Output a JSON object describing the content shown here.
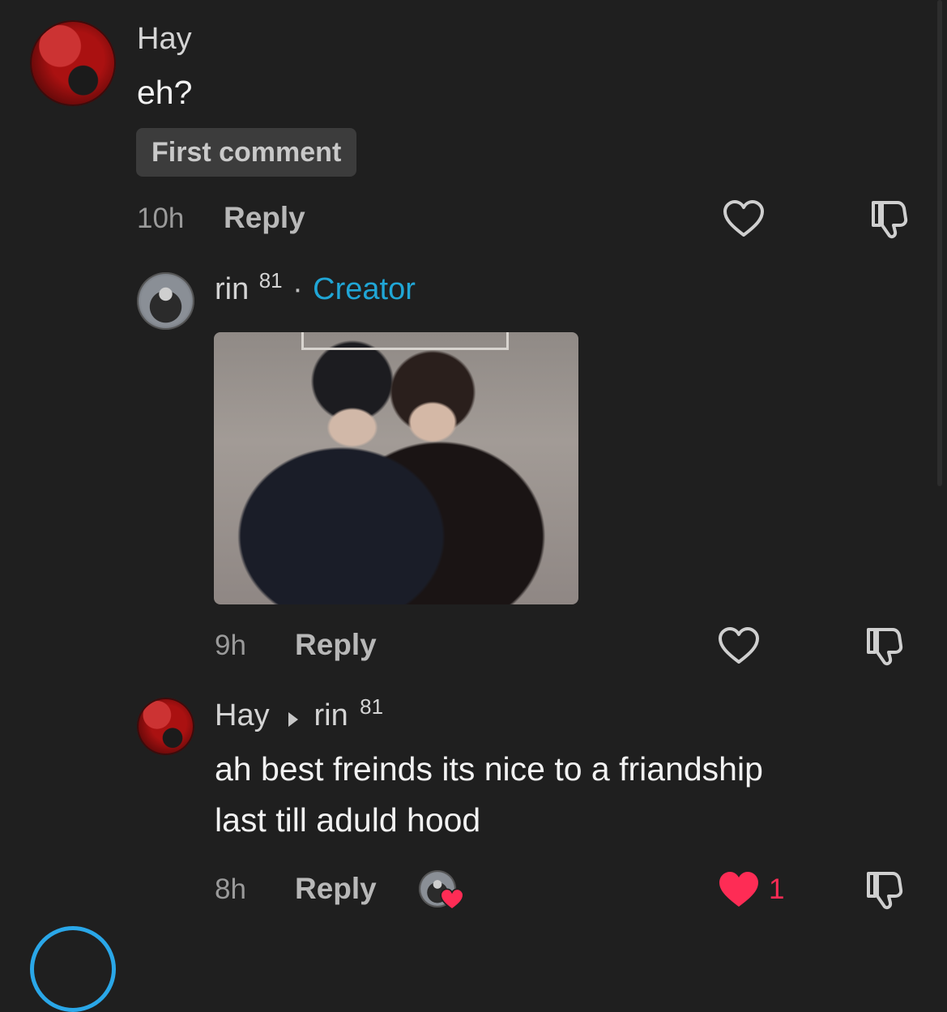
{
  "comments": [
    {
      "author": "Hay",
      "text": "eh?",
      "badge": "First comment",
      "time": "10h",
      "reply_label": "Reply"
    },
    {
      "author": "rin",
      "author_sup": "81",
      "separator": "·",
      "role": "Creator",
      "time": "9h",
      "reply_label": "Reply"
    },
    {
      "author": "Hay",
      "reply_to": "rin",
      "reply_to_sup": "81",
      "text_line1": "ah best freinds its nice to a friandship",
      "text_line2": "last till aduld hood",
      "time": "8h",
      "reply_label": "Reply",
      "like_count": "1"
    }
  ],
  "colors": {
    "accent": "#20a6d6",
    "like": "#fe2c55",
    "background": "#1f1f1f"
  },
  "icons": [
    "heart-outline-icon",
    "dislike-icon",
    "heart-filled-icon",
    "reply-arrow-icon"
  ]
}
